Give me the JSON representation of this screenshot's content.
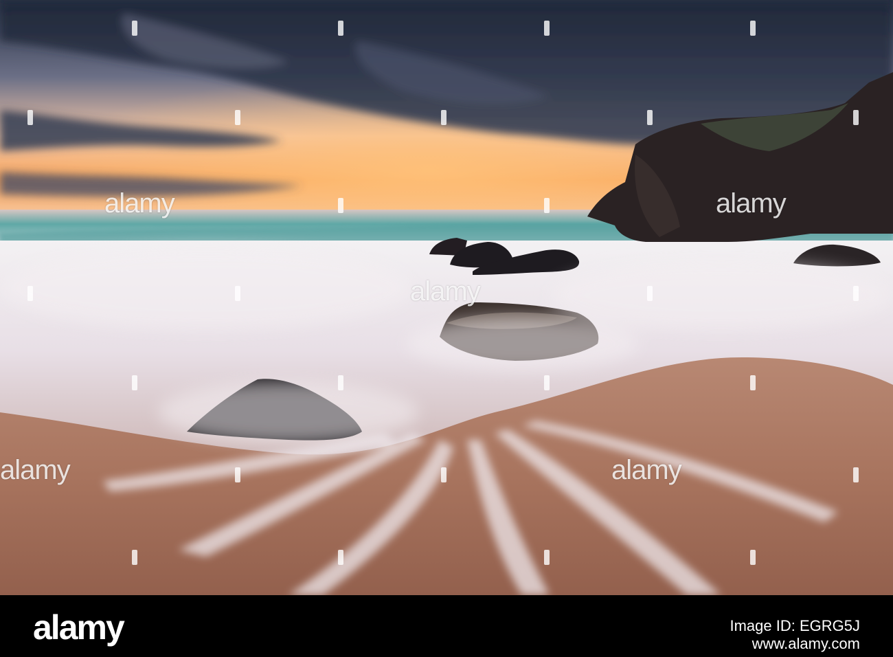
{
  "photo": {
    "subject": "beach-sunset-waves-rocks",
    "colors": {
      "sky_top": "#2b3448",
      "sky_glow": "#f7a55c",
      "horizon": "#f6c9a4",
      "sea": "#5fa8a6",
      "foam": "#f3f1f3",
      "sand": "#a8745e",
      "rock": "#1e1b20",
      "cliff": "#2a2223"
    }
  },
  "watermark": {
    "text": "alamy"
  },
  "footer": {
    "logo": "alamy",
    "image_id_label": "Image ID:",
    "image_id": "EGRG5J",
    "url": "www.alamy.com",
    "background": "#000000"
  }
}
